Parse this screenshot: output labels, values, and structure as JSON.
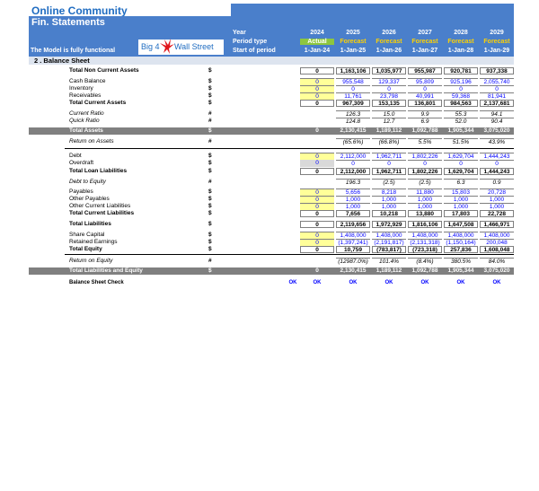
{
  "header": {
    "title": "Online Community",
    "subtitle": "Fin. Statements",
    "model_text": "The Model is fully functional",
    "logo_left": "Big 4",
    "logo_right": "Wall Street",
    "row_labels": [
      "Year",
      "Period type",
      "Start of period"
    ],
    "columns": [
      {
        "year": "2024",
        "type": "Actual",
        "start": "1-Jan-24"
      },
      {
        "year": "2025",
        "type": "Forecast",
        "start": "1-Jan-25"
      },
      {
        "year": "2026",
        "type": "Forecast",
        "start": "1-Jan-26"
      },
      {
        "year": "2027",
        "type": "Forecast",
        "start": "1-Jan-27"
      },
      {
        "year": "2028",
        "type": "Forecast",
        "start": "1-Jan-28"
      },
      {
        "year": "2029",
        "type": "Forecast",
        "start": "1-Jan-29"
      }
    ]
  },
  "section_title": "2 . Balance Sheet",
  "rows": [
    {
      "label": "Total Non Current Assets",
      "unit": "$",
      "style": "bold",
      "col0": "0",
      "vals": [
        "1,163,106",
        "1,035,977",
        "955,987",
        "920,781",
        "937,338"
      ]
    },
    {
      "label": "Cash Balance",
      "unit": "$",
      "style": "",
      "col0": "0",
      "vals": [
        "955,548",
        "129,337",
        "95,809",
        "925,196",
        "2,055,740"
      ]
    },
    {
      "label": "Inventory",
      "unit": "$",
      "style": "",
      "col0": "0",
      "vals": [
        "0",
        "0",
        "0",
        "0",
        "0"
      ]
    },
    {
      "label": "Receivables",
      "unit": "$",
      "style": "",
      "col0": "0",
      "vals": [
        "11,761",
        "23,798",
        "40,991",
        "59,368",
        "81,941"
      ]
    },
    {
      "label": "Total Current Assets",
      "unit": "$",
      "style": "bold",
      "col0": "0",
      "vals": [
        "967,309",
        "153,135",
        "136,801",
        "984,563",
        "2,137,681"
      ]
    },
    {
      "label": "Current Ratio",
      "unit": "#",
      "style": "ital",
      "col0": "",
      "vals": [
        "126.3",
        "15.0",
        "9.9",
        "55.3",
        "94.1"
      ]
    },
    {
      "label": "Quick Ratio",
      "unit": "#",
      "style": "ital",
      "col0": "",
      "vals": [
        "124.8",
        "12.7",
        "6.9",
        "52.0",
        "90.4"
      ]
    },
    {
      "label": "Total Assets",
      "unit": "$",
      "style": "total",
      "col0": "0",
      "vals": [
        "2,130,415",
        "1,189,112",
        "1,092,788",
        "1,905,344",
        "3,075,020"
      ]
    },
    {
      "label": "Return on Assets",
      "unit": "#",
      "style": "ital",
      "col0": "",
      "vals": [
        "(65.6%)",
        "(66.8%)",
        "5.5%",
        "51.5%",
        "43.9%"
      ]
    },
    {
      "label": "Debt",
      "unit": "$",
      "style": "",
      "col0": "0",
      "vals": [
        "2,112,000",
        "1,962,711",
        "1,802,226",
        "1,629,704",
        "1,444,243"
      ]
    },
    {
      "label": "Overdraft",
      "unit": "$",
      "style": "",
      "col0": "0",
      "vals": [
        "0",
        "0",
        "0",
        "0",
        "0"
      ]
    },
    {
      "label": "Total Loan Liabilities",
      "unit": "$",
      "style": "bold",
      "col0": "0",
      "vals": [
        "2,112,000",
        "1,962,711",
        "1,802,226",
        "1,629,704",
        "1,444,243"
      ]
    },
    {
      "label": "Debt to Equity",
      "unit": "#",
      "style": "ital",
      "col0": "",
      "vals": [
        "196.3",
        "(2.5)",
        "(2.5)",
        "6.3",
        "0.9"
      ]
    },
    {
      "label": "Payables",
      "unit": "$",
      "style": "",
      "col0": "0",
      "vals": [
        "5,656",
        "8,218",
        "11,880",
        "15,803",
        "20,728"
      ]
    },
    {
      "label": "Other  Payables",
      "unit": "$",
      "style": "",
      "col0": "0",
      "vals": [
        "1,000",
        "1,000",
        "1,000",
        "1,000",
        "1,000"
      ]
    },
    {
      "label": "Other Current Liabilities",
      "unit": "$",
      "style": "",
      "col0": "0",
      "vals": [
        "1,000",
        "1,000",
        "1,000",
        "1,000",
        "1,000"
      ]
    },
    {
      "label": "Total Current Liabilities",
      "unit": "$",
      "style": "bold",
      "col0": "0",
      "vals": [
        "7,656",
        "10,218",
        "13,880",
        "17,803",
        "22,728"
      ]
    },
    {
      "label": "Total Liabilities",
      "unit": "$",
      "style": "bold",
      "col0": "0",
      "vals": [
        "2,119,656",
        "1,972,929",
        "1,816,106",
        "1,647,508",
        "1,466,971"
      ]
    },
    {
      "label": "Share Capital",
      "unit": "$",
      "style": "",
      "col0": "0",
      "vals": [
        "1,408,000",
        "1,408,000",
        "1,408,000",
        "1,408,000",
        "1,408,000"
      ]
    },
    {
      "label": "Retained Earnings",
      "unit": "$",
      "style": "",
      "col0": "0",
      "vals": [
        "(1,397,241)",
        "(2,191,817)",
        "(2,131,318)",
        "(1,150,164)",
        "200,048"
      ]
    },
    {
      "label": "Total Equity",
      "unit": "$",
      "style": "bold",
      "col0": "0",
      "vals": [
        "10,759",
        "(783,817)",
        "(723,318)",
        "257,836",
        "1,608,048"
      ]
    },
    {
      "label": "Return on Equity",
      "unit": "#",
      "style": "ital",
      "col0": "",
      "vals": [
        "(12987.0%)",
        "101.4%",
        "(8.4%)",
        "380.5%",
        "84.0%"
      ]
    },
    {
      "label": "Total Liabilities and Equity",
      "unit": "$",
      "style": "total",
      "col0": "0",
      "vals": [
        "2,130,415",
        "1,189,112",
        "1,092,788",
        "1,905,344",
        "3,075,020"
      ]
    }
  ],
  "check": {
    "label": "Balance Sheet Check",
    "values": [
      "OK",
      "OK",
      "OK",
      "OK",
      "OK",
      "OK",
      "OK"
    ]
  },
  "colors": {
    "header_blue": "#4a7fcb",
    "title_blue": "#1f6cc1",
    "forecast_yellow": "#ffd200",
    "actual_green": "#8dc63f",
    "input_yellow": "#ffff99",
    "total_gray": "#808080"
  }
}
